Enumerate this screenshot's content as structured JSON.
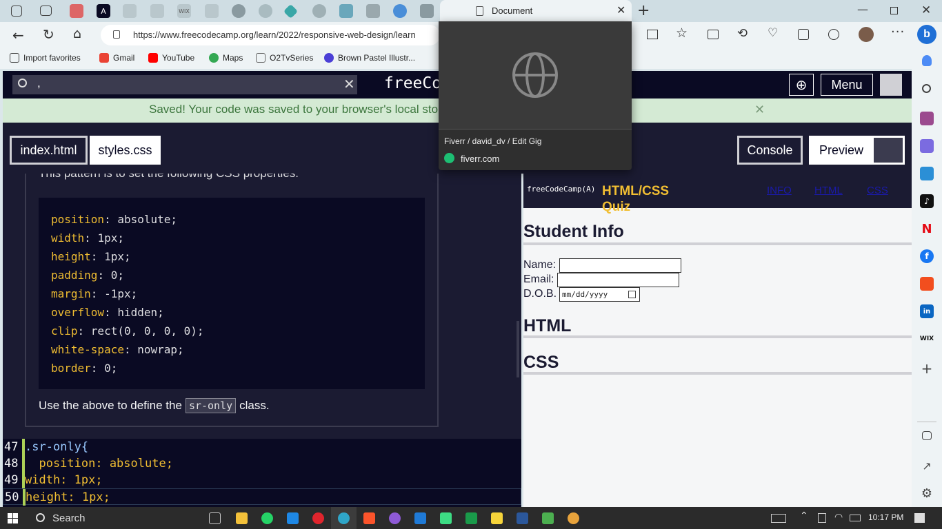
{
  "browser": {
    "active_tab_title": "Document",
    "url": "https://www.freecodecamp.org/learn/2022/responsive-web-design/learn",
    "favorites": [
      "Import favorites",
      "Gmail",
      "YouTube",
      "Maps",
      "O2TvSeries",
      "Brown Pastel Illustr..."
    ]
  },
  "hovercard": {
    "title": "Fiverr / david_dv / Edit Gig",
    "domain": "fiverr.com"
  },
  "fcc": {
    "search_value": ",",
    "brand": "freeCodeCamp",
    "menu_label": "Menu",
    "saved_message": "Saved! Your code was saved to your browser's local storage.",
    "tabs": [
      "index.html",
      "styles.css"
    ],
    "console_label": "Console",
    "preview_label": "Preview"
  },
  "instructions": {
    "intro_partial": "This pattern is to set the following CSS properties:",
    "css_lines": [
      {
        "prop": "position",
        "val": "absolute"
      },
      {
        "prop": "width",
        "val": "1px"
      },
      {
        "prop": "height",
        "val": "1px"
      },
      {
        "prop": "padding",
        "val": "0"
      },
      {
        "prop": "margin",
        "val": "-1px"
      },
      {
        "prop": "overflow",
        "val": "hidden"
      },
      {
        "prop": "clip",
        "val": "rect(0, 0, 0, 0)"
      },
      {
        "prop": "white-space",
        "val": "nowrap"
      },
      {
        "prop": "border",
        "val": "0"
      }
    ],
    "outro_before": "Use the above to define the",
    "outro_code": "sr-only",
    "outro_after": "class."
  },
  "editor": {
    "lines": [
      {
        "num": "47",
        "text": ".sr-only{"
      },
      {
        "num": "48",
        "text": "  position: absolute;"
      },
      {
        "num": "49",
        "text": "width: 1px;"
      },
      {
        "num": "50",
        "text": "height: 1px;"
      }
    ]
  },
  "preview": {
    "logo": "freeCodeCamp(A)",
    "title": "HTML/CSS Quiz",
    "nav": [
      "INFO",
      "HTML",
      "CSS"
    ],
    "section1": "Student Info",
    "name_label": "Name:",
    "email_label": "Email:",
    "dob_label": "D.O.B.",
    "dob_placeholder": "mm/dd/yyyy",
    "section2": "HTML",
    "section3": "CSS"
  },
  "taskbar": {
    "search": "Search",
    "time": "10:17 PM"
  },
  "colors": {
    "fcc_dark": "#0a0a23",
    "fcc_panel": "#1b1b32",
    "fcc_yellow": "#f1be32",
    "saved_banner": "#d4ead4"
  }
}
